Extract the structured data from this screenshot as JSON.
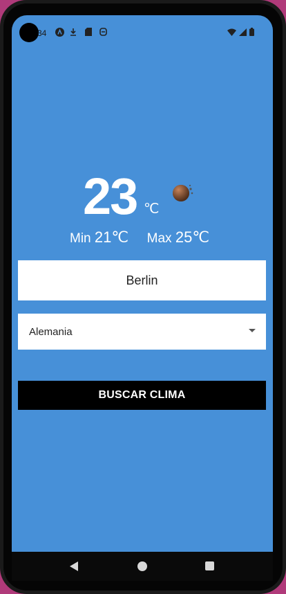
{
  "status_bar": {
    "time": "34"
  },
  "weather": {
    "temperature": "23",
    "unit": "℃",
    "min_label": "Min",
    "min_value": "21℃",
    "max_label": "Max",
    "max_value": "25℃",
    "icon": "weather-icon"
  },
  "form": {
    "city_value": "Berlin",
    "country_value": "Alemania",
    "search_button_label": "BUSCAR CLIMA"
  },
  "colors": {
    "background": "#4790d8",
    "button": "#000000",
    "text_on_bg": "#ffffff"
  }
}
